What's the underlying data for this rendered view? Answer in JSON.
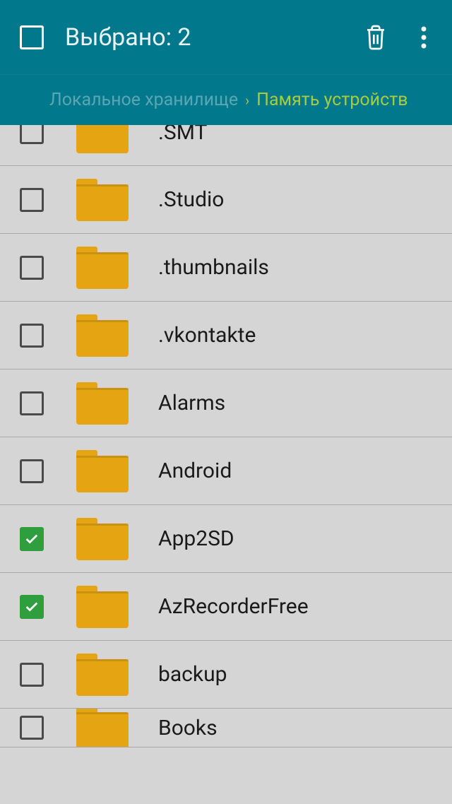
{
  "toolbar": {
    "title": "Выбрано: 2"
  },
  "breadcrumb": {
    "prev": "Локальное хранилище",
    "current": "Память устройств"
  },
  "items": [
    {
      "label": ".SMT",
      "checked": false
    },
    {
      "label": ".Studio",
      "checked": false
    },
    {
      "label": ".thumbnails",
      "checked": false
    },
    {
      "label": ".vkontakte",
      "checked": false
    },
    {
      "label": "Alarms",
      "checked": false
    },
    {
      "label": "Android",
      "checked": false
    },
    {
      "label": "App2SD",
      "checked": true
    },
    {
      "label": "AzRecorderFree",
      "checked": true
    },
    {
      "label": "backup",
      "checked": false
    },
    {
      "label": "Books",
      "checked": false
    }
  ]
}
